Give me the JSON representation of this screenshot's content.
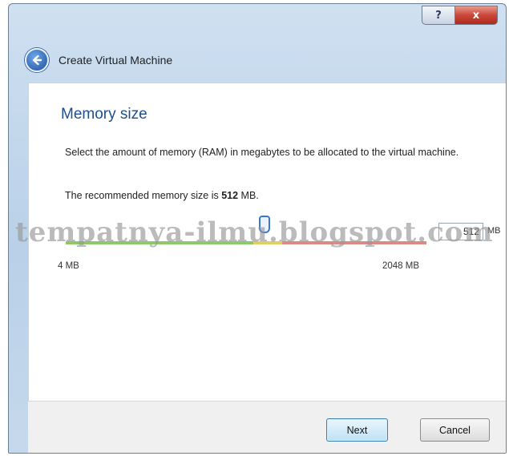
{
  "window": {
    "title_bar_buttons": {
      "help_label": "?",
      "close_label": "x"
    }
  },
  "header": {
    "back_icon": "back-arrow-icon",
    "title": "Create Virtual Machine"
  },
  "page": {
    "section_title": "Memory size",
    "description": "Select the amount of memory (RAM) in megabytes to be allocated to the virtual machine.",
    "recommended_prefix": "The recommended memory size is ",
    "recommended_value": "512",
    "recommended_suffix": " MB."
  },
  "memory_slider": {
    "value_mb": 512,
    "min_mb": 4,
    "max_mb": 2048,
    "min_label": "4 MB",
    "max_label": "2048 MB",
    "input_value": "512",
    "unit_label": "MB",
    "colors": {
      "ok": "#8cc96a",
      "warn": "#e2cf63",
      "danger": "#d98b86"
    }
  },
  "watermark": "tempatnya-ilmu.blogspot.com",
  "footer": {
    "next_label": "Next",
    "cancel_label": "Cancel"
  },
  "colors": {
    "title_blue": "#1e4e8e",
    "accent": "#3d77c9"
  }
}
